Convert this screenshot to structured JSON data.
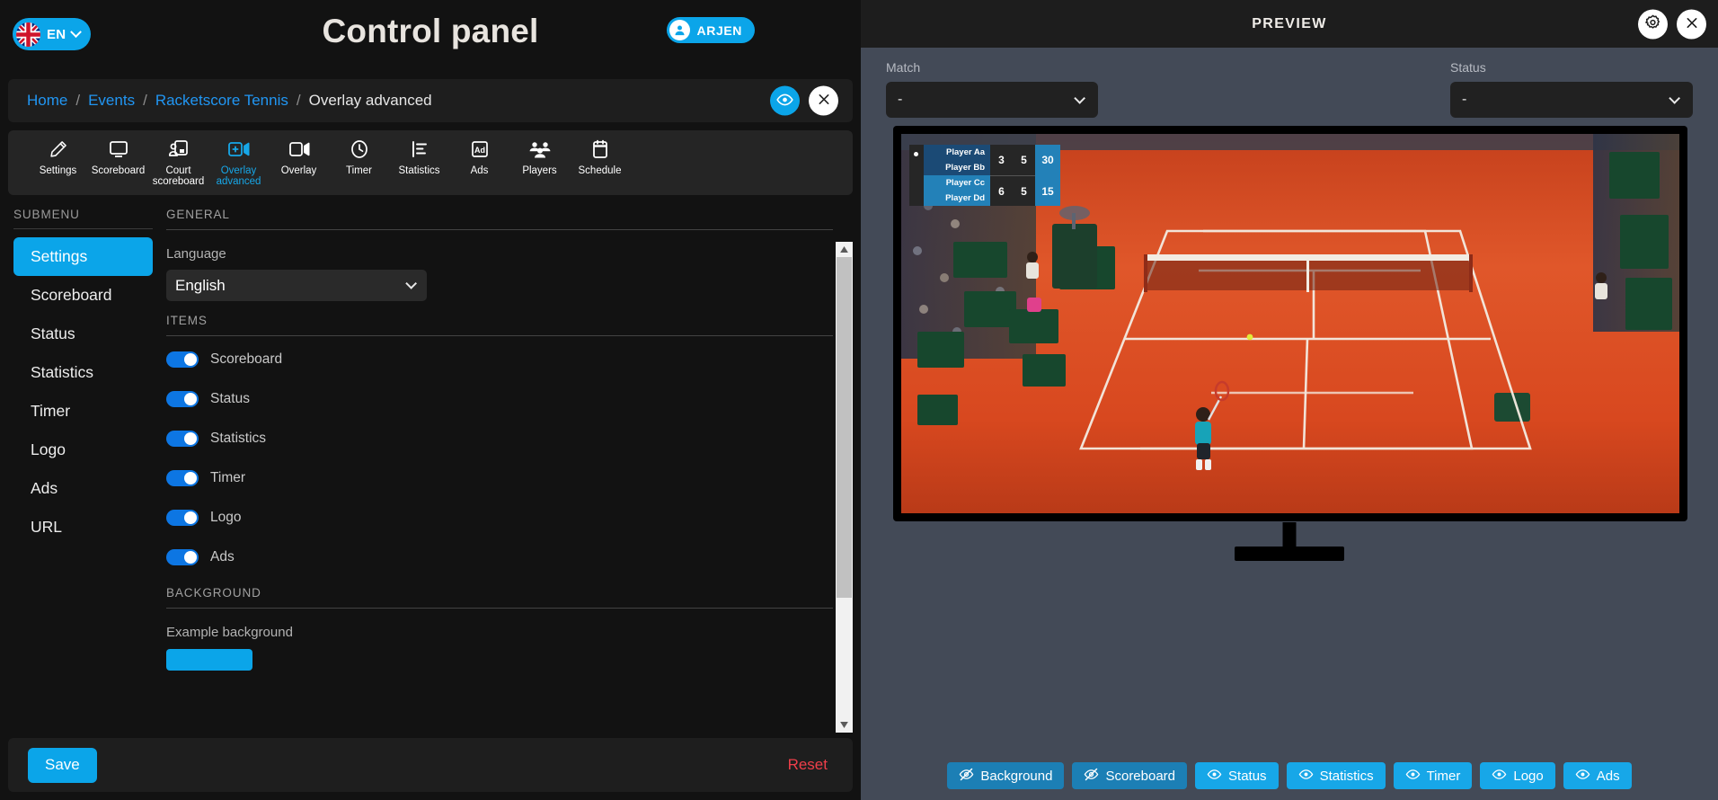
{
  "header": {
    "app_title": "Control panel",
    "language_pill": {
      "code": "EN",
      "icon": "uk-flag-icon",
      "chevron": "chevron-down-icon"
    },
    "user": {
      "name": "ARJEN",
      "icon": "user-avatar-icon"
    }
  },
  "breadcrumb": {
    "items": [
      {
        "label": "Home",
        "link": true
      },
      {
        "label": "Events",
        "link": true
      },
      {
        "label": "Racketscore Tennis",
        "link": true
      },
      {
        "label": "Overlay advanced",
        "link": false
      }
    ],
    "separator": "/",
    "actions": [
      {
        "name": "preview-toggle-button",
        "icon": "eye-icon"
      },
      {
        "name": "close-button",
        "icon": "close-icon"
      }
    ]
  },
  "toolbar": {
    "items": [
      {
        "label": "Settings",
        "icon": "pencil-icon",
        "active": false
      },
      {
        "label": "Scoreboard",
        "icon": "monitor-icon",
        "active": false
      },
      {
        "label": "Court scoreboard",
        "icon": "court-scoreboard-icon",
        "active": false
      },
      {
        "label": "Overlay advanced",
        "icon": "overlay-advanced-icon",
        "active": true
      },
      {
        "label": "Overlay",
        "icon": "video-camera-icon",
        "active": false
      },
      {
        "label": "Timer",
        "icon": "clock-icon",
        "active": false
      },
      {
        "label": "Statistics",
        "icon": "bar-chart-icon",
        "active": false
      },
      {
        "label": "Ads",
        "icon": "ad-icon",
        "active": false
      },
      {
        "label": "Players",
        "icon": "people-icon",
        "active": false
      },
      {
        "label": "Schedule",
        "icon": "calendar-icon",
        "active": false
      }
    ]
  },
  "submenu": {
    "title": "SUBMENU",
    "items": [
      {
        "label": "Settings",
        "active": true
      },
      {
        "label": "Scoreboard",
        "active": false
      },
      {
        "label": "Status",
        "active": false
      },
      {
        "label": "Statistics",
        "active": false
      },
      {
        "label": "Timer",
        "active": false
      },
      {
        "label": "Logo",
        "active": false
      },
      {
        "label": "Ads",
        "active": false
      },
      {
        "label": "URL",
        "active": false
      }
    ]
  },
  "form": {
    "general_heading": "GENERAL",
    "language_label": "Language",
    "language_value": "English",
    "items_heading": "ITEMS",
    "toggles": [
      {
        "label": "Scoreboard",
        "on": true
      },
      {
        "label": "Status",
        "on": true
      },
      {
        "label": "Statistics",
        "on": true
      },
      {
        "label": "Timer",
        "on": true
      },
      {
        "label": "Logo",
        "on": true
      },
      {
        "label": "Ads",
        "on": true
      }
    ],
    "background_heading": "BACKGROUND",
    "background_label": "Example background",
    "background_color": "#0ba5e9"
  },
  "footer": {
    "save_label": "Save",
    "reset_label": "Reset"
  },
  "preview": {
    "title": "PREVIEW",
    "head_buttons": [
      {
        "name": "settings-gear-button",
        "icon": "gear-icon"
      },
      {
        "name": "close-preview-button",
        "icon": "close-icon"
      }
    ],
    "match_label": "Match",
    "match_value": "-",
    "status_label": "Status",
    "status_value": "-",
    "scoreboard": {
      "rows": [
        {
          "team": [
            "Player Aa",
            "Player Bb"
          ],
          "sets": [
            "3",
            "5"
          ],
          "game": "30",
          "serving": true
        },
        {
          "team": [
            "Player Cc",
            "Player Dd"
          ],
          "sets": [
            "6",
            "5"
          ],
          "game": "15",
          "serving": false
        }
      ]
    },
    "buttons": [
      {
        "label": "Background",
        "icon": "eye-slash-icon",
        "on": false
      },
      {
        "label": "Scoreboard",
        "icon": "eye-slash-icon",
        "on": false
      },
      {
        "label": "Status",
        "icon": "eye-icon",
        "on": true
      },
      {
        "label": "Statistics",
        "icon": "eye-icon",
        "on": true
      },
      {
        "label": "Timer",
        "icon": "eye-icon",
        "on": true
      },
      {
        "label": "Logo",
        "icon": "eye-icon",
        "on": true
      },
      {
        "label": "Ads",
        "icon": "eye-icon",
        "on": true
      }
    ]
  },
  "colors": {
    "accent": "#0ba5e9",
    "accent_bright": "#17a7e8",
    "accent_muted": "#1c7fb5",
    "danger": "#ef3f4a",
    "panel_bg": "#121212",
    "preview_bg": "#434a57"
  }
}
